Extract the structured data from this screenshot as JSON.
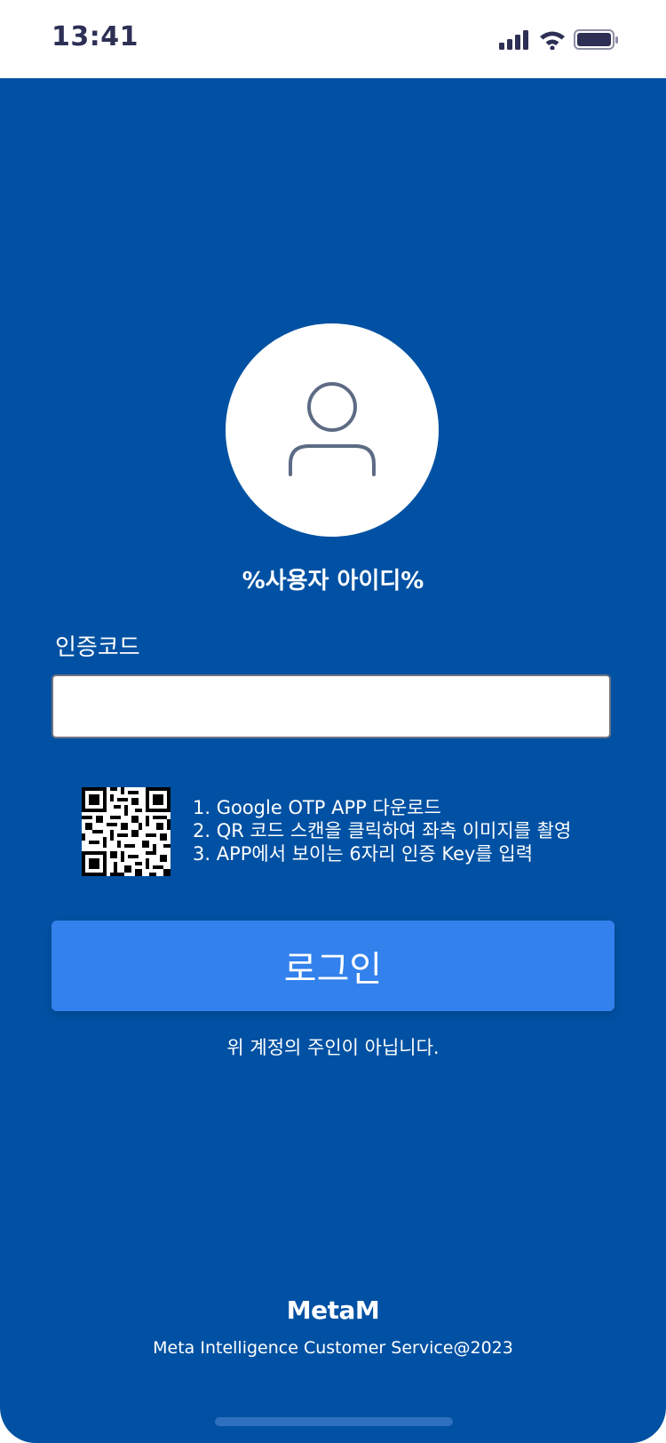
{
  "status_bar": {
    "time": "13:41"
  },
  "profile": {
    "username": "%사용자 아이디%"
  },
  "auth": {
    "label": "인증코드",
    "input_value": "",
    "input_placeholder": ""
  },
  "instructions": {
    "line1": "1. Google OTP APP 다운로드",
    "line2": "2. QR 코드 스캔을 클릭하여 좌측 이미지를 촬영",
    "line3": "3. APP에서 보이는 6자리 인증 Key를 입력"
  },
  "actions": {
    "login_label": "로그인",
    "not_owner_label": "위 계정의 주인이 아닙니다."
  },
  "footer": {
    "brand": "MetaM",
    "copyright": "Meta Intelligence Customer Service@2023"
  },
  "colors": {
    "background": "#0051a3",
    "button": "#3381ec",
    "status_text": "#2d2f55",
    "avatar_stroke": "#5d6b84"
  },
  "icons": {
    "signal": "cellular-signal-icon",
    "wifi": "wifi-icon",
    "battery": "battery-icon",
    "avatar": "user-icon",
    "qr": "qr-code-icon"
  }
}
